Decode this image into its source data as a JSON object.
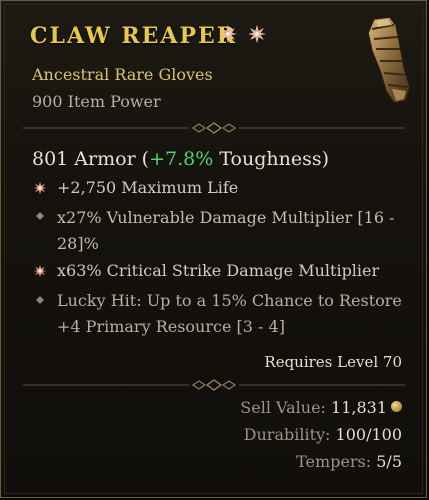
{
  "item": {
    "name": "CLAW REAPER",
    "type": "Ancestral Rare Gloves",
    "item_power": "900 Item Power"
  },
  "armor": {
    "value": "801 Armor (",
    "bonus": "+7.8%",
    "label": " Toughness)"
  },
  "affixes": [
    {
      "text": "+2,750 Maximum Life",
      "greater": true
    },
    {
      "text": "x27% Vulnerable Damage Multiplier [16 - 28]%",
      "line1": "x27% Vulnerable Damage Multiplier [16 -",
      "line2": "28]%",
      "greater": false
    },
    {
      "text": "x63% Critical Strike Damage Multiplier",
      "greater": true
    },
    {
      "line1": "Lucky Hit: Up to a 15% Chance to Restore",
      "line2": "+4 Primary Resource [3 - 4]",
      "greater": false
    }
  ],
  "requirement": "Requires Level 70",
  "footer": {
    "sell_label": "Sell Value:",
    "sell_value": "11,831",
    "durability_label": "Durability:",
    "durability_value": "100/100",
    "tempers_label": "Tempers:",
    "tempers_value": "5/5"
  },
  "colors": {
    "title": "#e8c84a",
    "rare_type": "#d8c56b",
    "positive": "#4fd36a",
    "greater_affix": "#e8a08a"
  },
  "icons": [
    "greater-affix-star-icon",
    "affix-diamond-icon",
    "gloves-icon",
    "gold-coin-icon",
    "divider-ornament-icon"
  ]
}
